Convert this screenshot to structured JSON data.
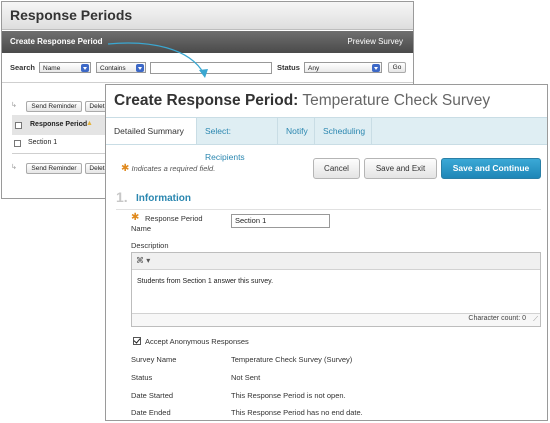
{
  "back_window": {
    "title": "Response Periods",
    "action_bar": {
      "create_label": "Create Response Period",
      "preview_label": "Preview Survey"
    },
    "search": {
      "label": "Search",
      "field_select": "Name",
      "operator_select": "Contains",
      "search_value": "",
      "status_label": "Status",
      "status_select": "Any",
      "go_label": "Go"
    },
    "top_buttons": {
      "send_reminder": "Send Reminder",
      "delete": "Delet"
    },
    "table": {
      "column_header": "Response Period",
      "rows": [
        "Section 1"
      ]
    },
    "bottom_buttons": {
      "send_reminder": "Send Reminder",
      "delete": "Delet"
    }
  },
  "front_window": {
    "title_bold": "Create Response Period:",
    "title_rest": "Temperature Check Survey",
    "tabs": [
      "Detailed Summary",
      "Select: Recipients",
      "Notify",
      "Scheduling"
    ],
    "required_note": "Indicates a required field.",
    "buttons": {
      "cancel": "Cancel",
      "save_exit": "Save and Exit",
      "save_continue": "Save and Continue"
    },
    "section": {
      "number": "1.",
      "title": "Information"
    },
    "fields": {
      "response_period_label_1": "Response Period",
      "response_period_label_2": "Name",
      "response_period_value": "Section 1",
      "description_label": "Description",
      "description_text": "Students from Section 1 answer this survey.",
      "char_count": "Character count: 0",
      "anonymous_label": "Accept Anonymous Responses",
      "anonymous_checked": true
    },
    "info_rows": [
      {
        "label": "Survey Name",
        "value": "Temperature Check Survey (Survey)"
      },
      {
        "label": "Status",
        "value": "Not Sent"
      },
      {
        "label": "Date Started",
        "value": "This Response Period is not open."
      },
      {
        "label": "Date Ended",
        "value": "This Response Period has no end date."
      }
    ]
  },
  "colors": {
    "accent": "#2b87b0",
    "primary_button": "#1e86b7",
    "required_star": "#e08a1e",
    "connector": "#3aa7d1"
  }
}
